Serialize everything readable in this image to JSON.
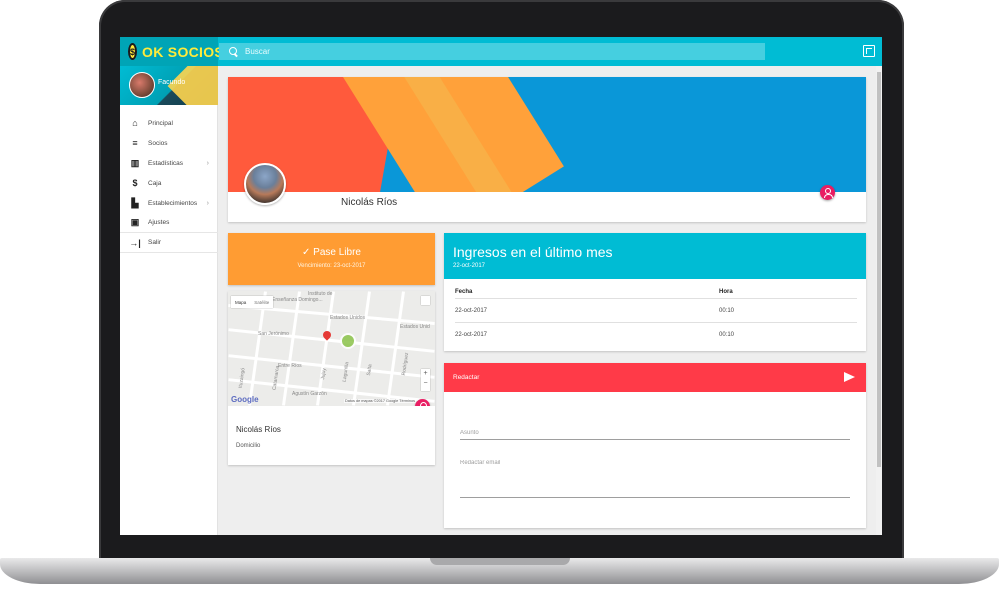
{
  "app": {
    "brand": "OK SOCIOS"
  },
  "search": {
    "placeholder": "Buscar"
  },
  "user": {
    "name": "Facundo"
  },
  "sidebar": {
    "items": [
      {
        "label": "Principal",
        "icon": "home-icon",
        "glyph": "⌂"
      },
      {
        "label": "Socios",
        "icon": "list-icon",
        "glyph": "≡"
      },
      {
        "label": "Estadísticas",
        "icon": "chart-icon",
        "glyph": "▥",
        "arrow": "›"
      },
      {
        "label": "Caja",
        "icon": "dollar-icon",
        "glyph": "$"
      },
      {
        "label": "Establecimientos",
        "icon": "building-icon",
        "glyph": "▙",
        "arrow": "›"
      },
      {
        "label": "Ajustes",
        "icon": "settings-icon",
        "glyph": "▣"
      },
      {
        "label": "Salir",
        "icon": "exit-icon",
        "glyph": "→|"
      }
    ]
  },
  "profile": {
    "name": "Nicolás Ríos"
  },
  "pass": {
    "title": "✓ Pase Libre",
    "expiry": "Vencimiento: 23-oct-2017"
  },
  "map": {
    "tab_map": "Mapa",
    "tab_satellite": "Satélite",
    "labels": [
      "Instituto de",
      "Enseñanza Domingo...",
      "Estados Unidos",
      "Estados Unid",
      "San Jerónimo",
      "Entre Ríos",
      "Agustín Garzón",
      "Ituzaingó",
      "Jujuy",
      "Catamarca",
      "Salta",
      "Rodríguez",
      "Lagunilla"
    ],
    "google": "Google",
    "credit": "Datos de mapas ©2017 Google   Términos",
    "zoom_in": "+",
    "zoom_out": "−",
    "person_name": "Nicolás Ríos",
    "address_label": "Domicilio"
  },
  "ingresos": {
    "title": "Ingresos en el último mes",
    "date": "22-oct-2017",
    "columns": [
      "Fecha",
      "Hora"
    ],
    "rows": [
      [
        "22-oct-2017",
        "00:10"
      ],
      [
        "22-oct-2017",
        "00:10"
      ]
    ]
  },
  "compose": {
    "title": "Redactar",
    "subject_placeholder": "Asunto",
    "body_placeholder": "Redactar email"
  },
  "colors": {
    "primary": "#00bcd4",
    "accent_pink": "#e91e63",
    "pass_orange": "#ff9c33",
    "compose_red": "#ff3a48",
    "brand_yellow": "#ffeb3b"
  }
}
